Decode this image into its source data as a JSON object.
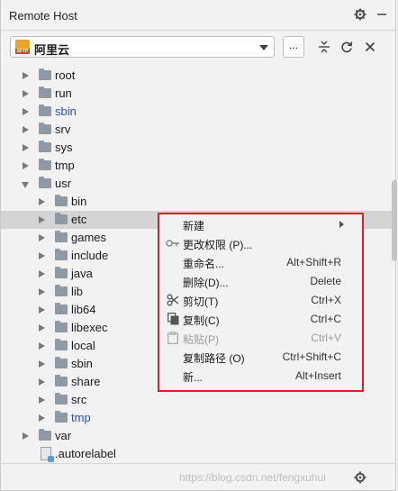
{
  "panel": {
    "title": "Remote Host",
    "host": "阿里云",
    "sftp_badge": "SFTP",
    "more_label": "..."
  },
  "tree": [
    {
      "label": "root",
      "link": false
    },
    {
      "label": "run",
      "link": false
    },
    {
      "label": "sbin",
      "link": true
    },
    {
      "label": "srv",
      "link": false
    },
    {
      "label": "sys",
      "link": false
    },
    {
      "label": "tmp",
      "link": false
    },
    {
      "label": "usr",
      "link": false
    },
    {
      "label": "bin",
      "link": false
    },
    {
      "label": "etc",
      "link": false
    },
    {
      "label": "games",
      "link": false
    },
    {
      "label": "include",
      "link": false
    },
    {
      "label": "java",
      "link": false
    },
    {
      "label": "lib",
      "link": false
    },
    {
      "label": "lib64",
      "link": false
    },
    {
      "label": "libexec",
      "link": false
    },
    {
      "label": "local",
      "link": false
    },
    {
      "label": "sbin",
      "link": false
    },
    {
      "label": "share",
      "link": false
    },
    {
      "label": "src",
      "link": false
    },
    {
      "label": "tmp",
      "link": true
    },
    {
      "label": "var",
      "link": false
    },
    {
      "label": ".autorelabel",
      "link": false
    }
  ],
  "context_menu": [
    {
      "label": "新建",
      "shortcut": "",
      "submenu": true,
      "icon": "",
      "disabled": false
    },
    {
      "label": "更改权限 (P)...",
      "shortcut": "",
      "submenu": false,
      "icon": "key-icon",
      "disabled": false
    },
    {
      "label": "重命名...",
      "shortcut": "Alt+Shift+R",
      "submenu": false,
      "icon": "",
      "disabled": false
    },
    {
      "label": "删除(D)...",
      "shortcut": "Delete",
      "submenu": false,
      "icon": "",
      "disabled": false
    },
    {
      "label": "剪切(T)",
      "shortcut": "Ctrl+X",
      "submenu": false,
      "icon": "scissors-icon",
      "disabled": false
    },
    {
      "label": "复制(C)",
      "shortcut": "Ctrl+C",
      "submenu": false,
      "icon": "copy-icon",
      "disabled": false
    },
    {
      "label": "粘贴(P)",
      "shortcut": "Ctrl+V",
      "submenu": false,
      "icon": "paste-icon",
      "disabled": true
    },
    {
      "label": "复制路径 (O)",
      "shortcut": "Ctrl+Shift+C",
      "submenu": false,
      "icon": "",
      "disabled": false
    },
    {
      "label": "新...",
      "shortcut": "Alt+Insert",
      "submenu": false,
      "icon": "",
      "disabled": false
    }
  ],
  "watermark": "https://blog.csdn.net/fengxuhui"
}
